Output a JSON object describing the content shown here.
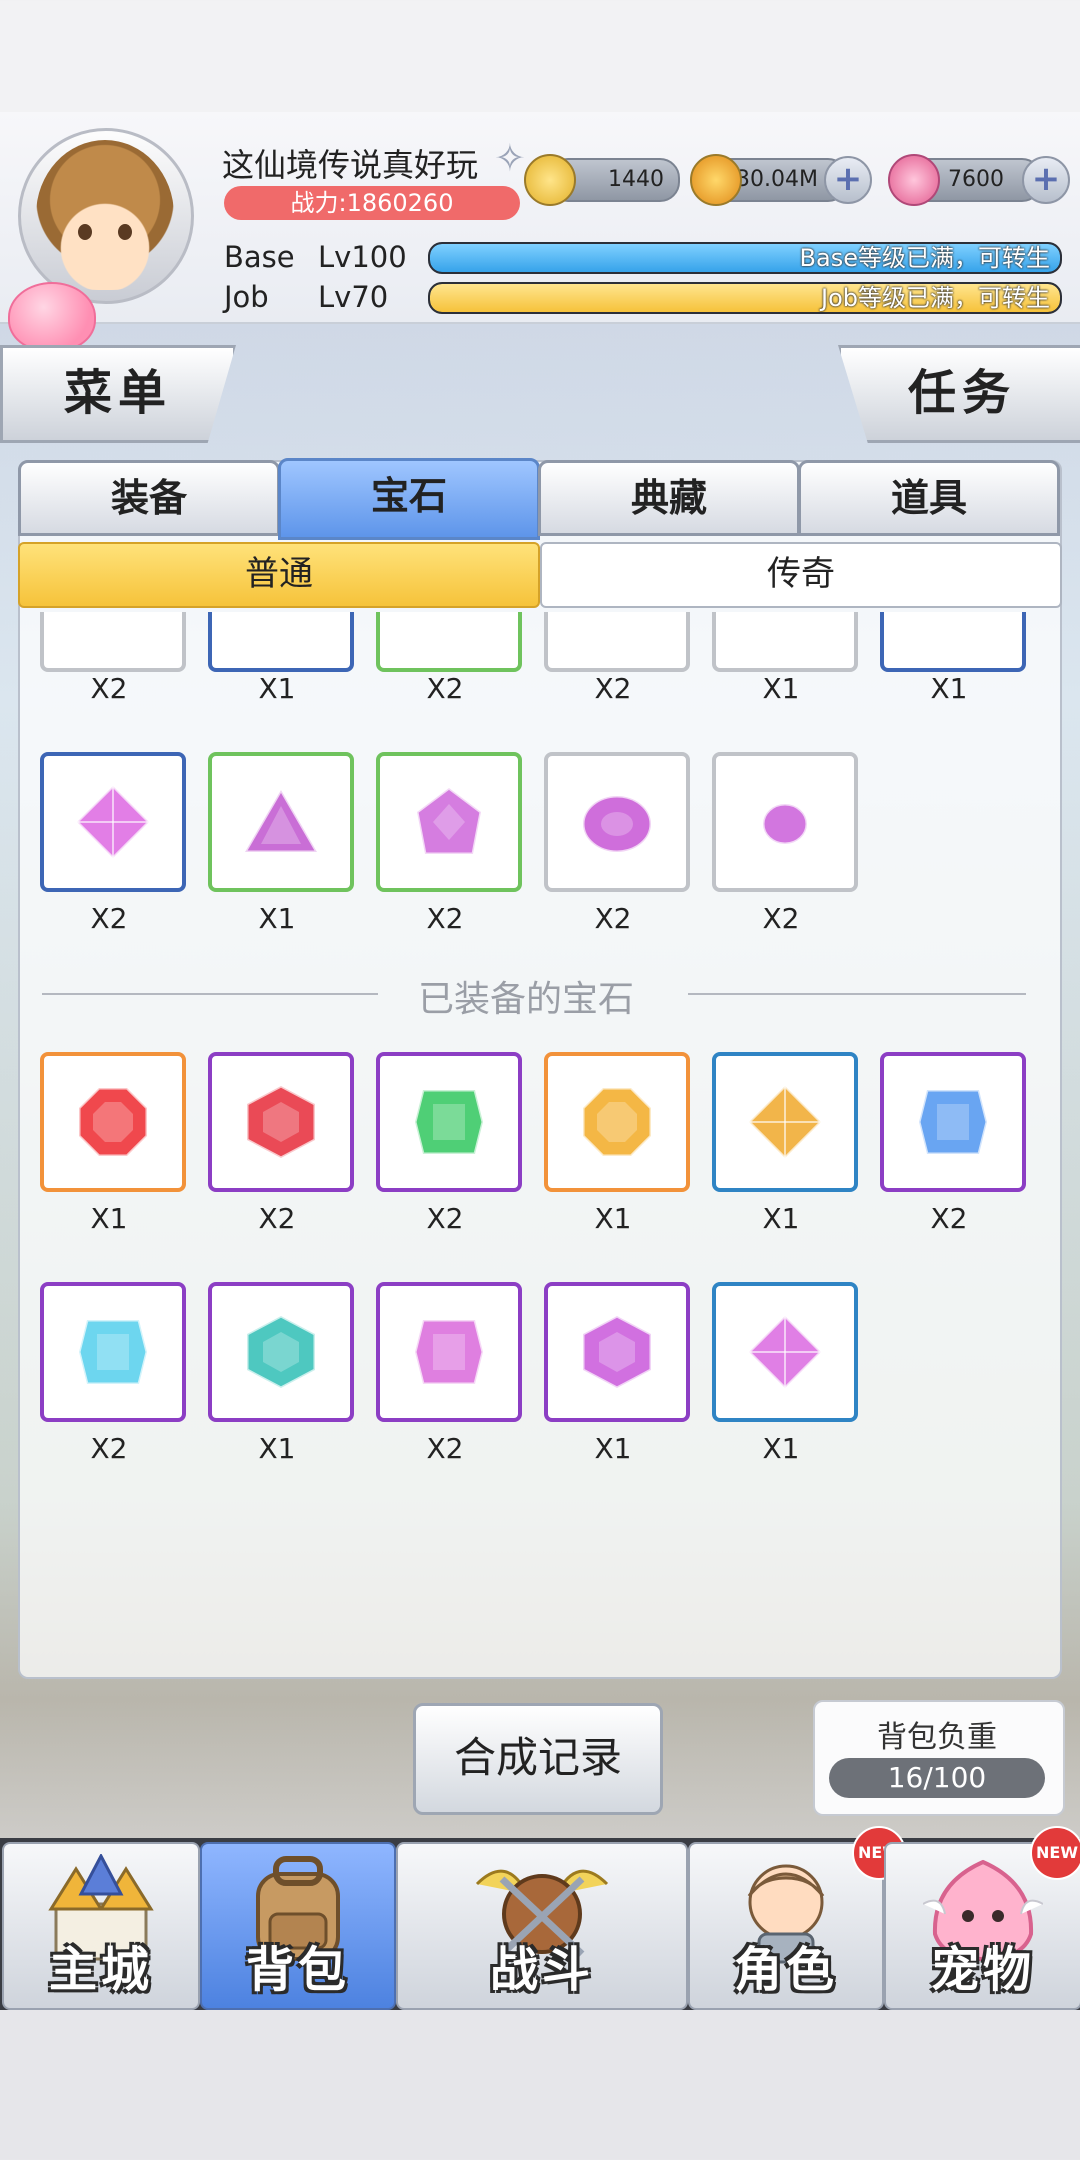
{
  "header": {
    "player_name": "这仙境传说真好玩",
    "combat_power": "战力:1860260",
    "currencies": [
      {
        "icon": "zeny-coin-icon",
        "value": "1440"
      },
      {
        "icon": "gold-coin-icon",
        "value": "30.04M"
      },
      {
        "icon": "pink-crystal-icon",
        "value": "7600"
      }
    ],
    "base": {
      "label": "Base",
      "level": "Lv100",
      "status": "Base等级已满，可转生",
      "progress": 1.0,
      "color": "#36a3ea"
    },
    "job": {
      "label": "Job",
      "level": "Lv70",
      "status": "Job等级已满，可转生",
      "progress": 1.0,
      "color": "#f6c23a"
    }
  },
  "side": {
    "menu": "菜单",
    "quest": "任务"
  },
  "tabs": [
    "装备",
    "宝石",
    "典藏",
    "道具"
  ],
  "active_tab": "宝石",
  "subtabs": [
    "普通",
    "传奇"
  ],
  "active_subtab": "普通",
  "gems_top_partial": [
    {
      "border": "gray",
      "qty": "X2"
    },
    {
      "border": "blue",
      "qty": "X1"
    },
    {
      "border": "green",
      "qty": "X2"
    },
    {
      "border": "gray",
      "qty": "X2"
    },
    {
      "border": "gray",
      "qty": "X1"
    },
    {
      "border": "blue",
      "qty": "X1"
    }
  ],
  "gems_row2": [
    {
      "border": "blue",
      "color": "#e27ee6",
      "shape": "diamond",
      "qty": "X2"
    },
    {
      "border": "green",
      "color": "#c96ed6",
      "shape": "triangle",
      "qty": "X1"
    },
    {
      "border": "green",
      "color": "#d57de0",
      "shape": "trillion",
      "qty": "X2"
    },
    {
      "border": "gray",
      "color": "#cf6edb",
      "shape": "oval",
      "qty": "X2"
    },
    {
      "border": "gray",
      "color": "#d276df",
      "shape": "small",
      "qty": "X2"
    }
  ],
  "equipped_title": "已装备的宝石",
  "equipped_row1": [
    {
      "border": "orange",
      "color": "#f0484d",
      "shape": "octagon",
      "qty": "X1"
    },
    {
      "border": "purple",
      "color": "#ea4a56",
      "shape": "hex",
      "qty": "X2"
    },
    {
      "border": "purple",
      "color": "#4fcf76",
      "shape": "square",
      "qty": "X2"
    },
    {
      "border": "orange",
      "color": "#f4b745",
      "shape": "octagon",
      "qty": "X1"
    },
    {
      "border": "cyan",
      "color": "#f2b54a",
      "shape": "diamond",
      "qty": "X1"
    },
    {
      "border": "purple",
      "color": "#69a5f2",
      "shape": "square",
      "qty": "X2"
    }
  ],
  "equipped_row2": [
    {
      "border": "purple",
      "color": "#6dd6ef",
      "shape": "square",
      "qty": "X2"
    },
    {
      "border": "purple",
      "color": "#4ec8c0",
      "shape": "hex",
      "qty": "X1"
    },
    {
      "border": "purple",
      "color": "#df7fe0",
      "shape": "square",
      "qty": "X2"
    },
    {
      "border": "purple",
      "color": "#d170e0",
      "shape": "hex",
      "qty": "X1"
    },
    {
      "border": "cyan",
      "color": "#e07fe5",
      "shape": "diamond",
      "qty": "X1"
    }
  ],
  "craft_record": "合成记录",
  "bag_weight": {
    "label": "背包负重",
    "value": "16/100"
  },
  "nav": [
    {
      "label": "主城",
      "icon": "castle-icon",
      "badge": ""
    },
    {
      "label": "背包",
      "icon": "backpack-icon",
      "badge": ""
    },
    {
      "label": "战斗",
      "icon": "crossed-swords-shield-icon",
      "badge": ""
    },
    {
      "label": "角色",
      "icon": "character-portrait-icon",
      "badge": "NEW"
    },
    {
      "label": "宠物",
      "icon": "poring-pet-icon",
      "badge": "NEW"
    }
  ],
  "active_nav": "背包"
}
